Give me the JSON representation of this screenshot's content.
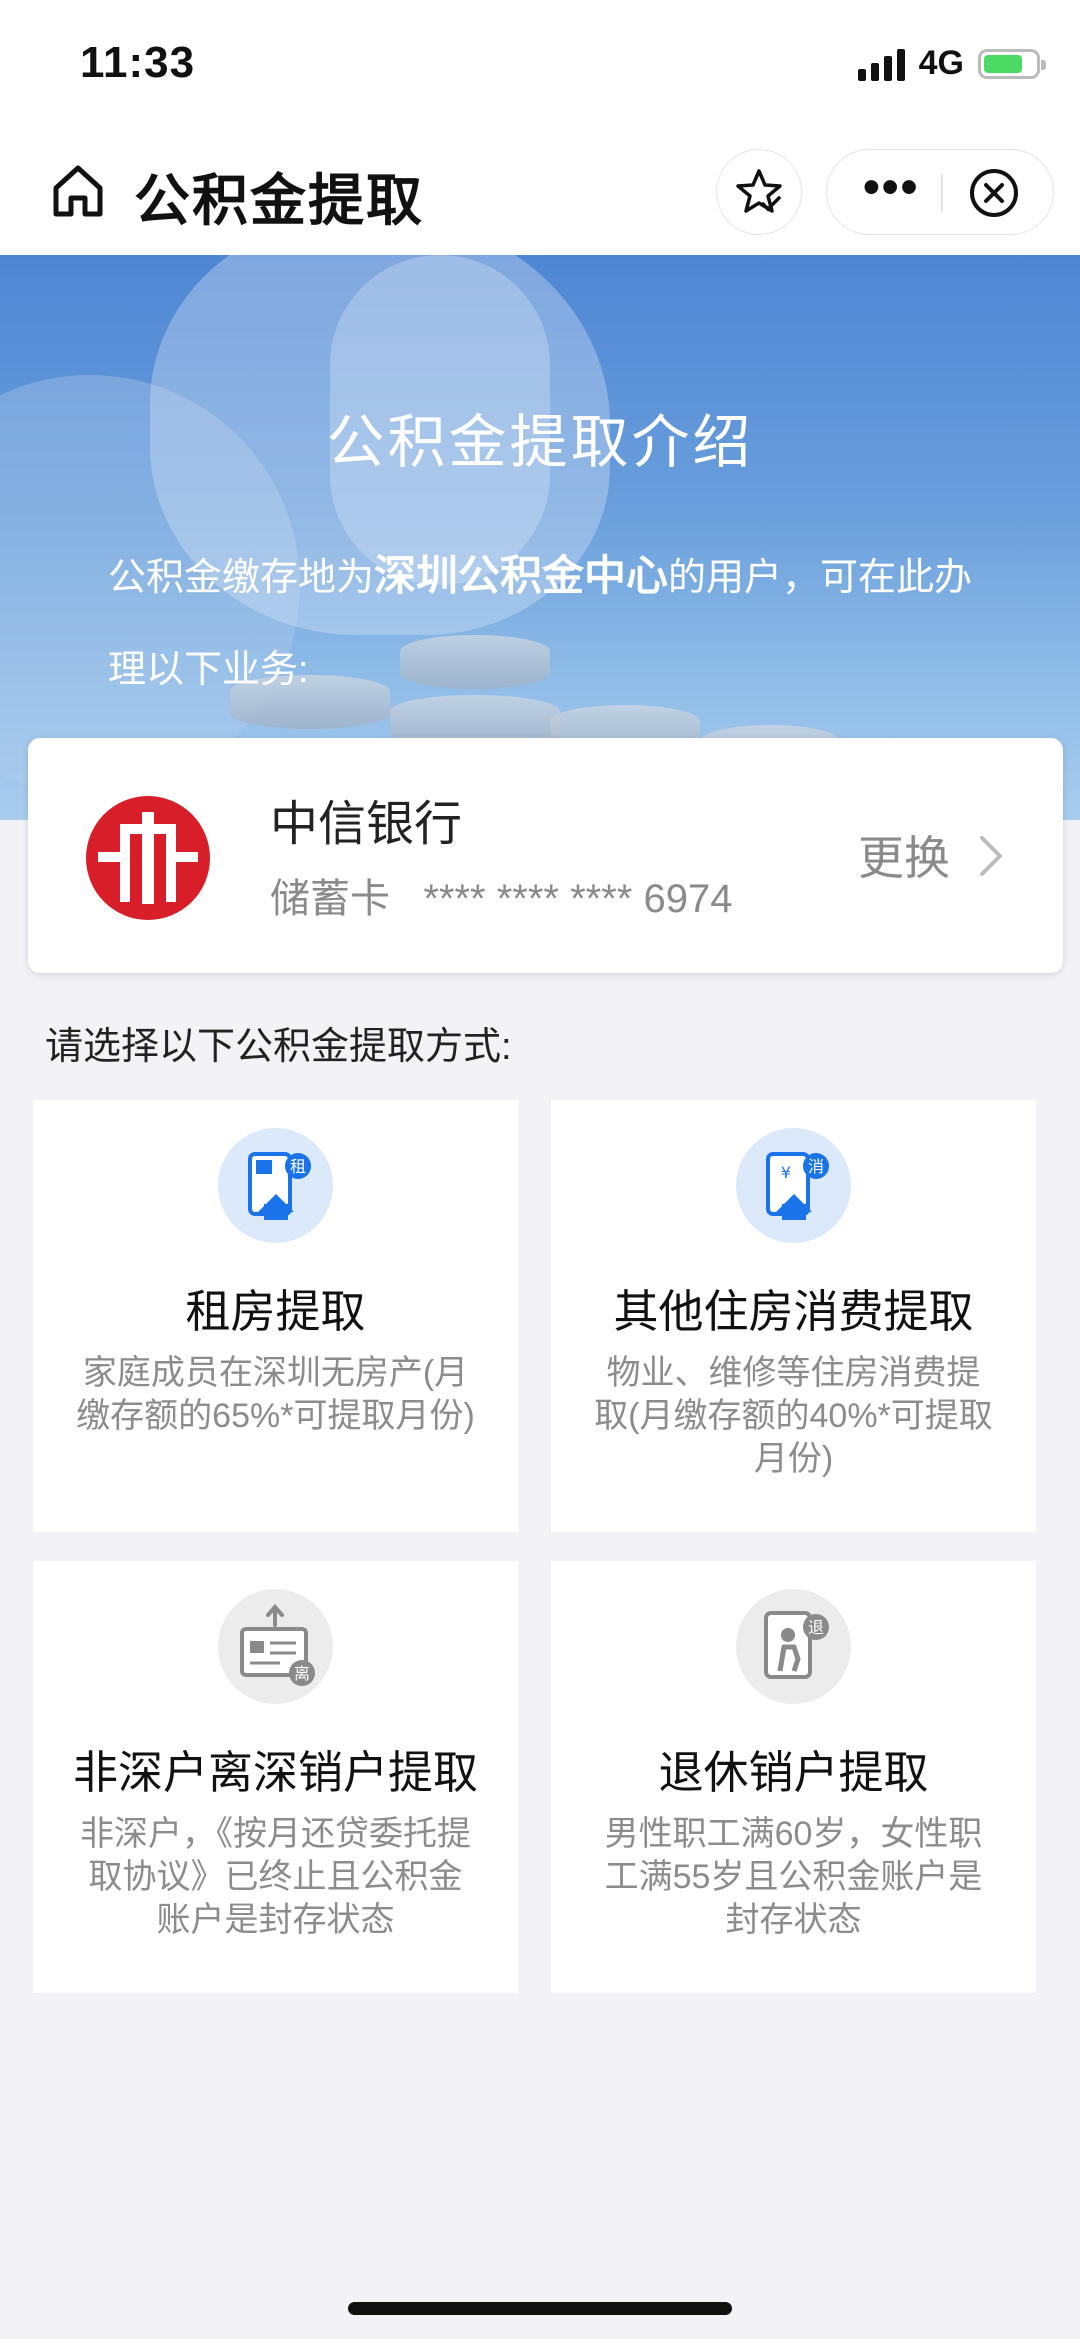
{
  "status_bar": {
    "time": "11:33",
    "network": "4G",
    "battery_level": 0.75
  },
  "navbar": {
    "title": "公积金提取",
    "icons": [
      "home-icon",
      "star-icon",
      "more-icon",
      "close-icon"
    ]
  },
  "banner": {
    "title": "公积金提取介绍",
    "text_prefix": "公积金缴存地为",
    "text_highlight": "深圳公积金中心",
    "text_suffix": "的用户，可在此办理以下业务:"
  },
  "bank_card": {
    "bank_name": "中信银行",
    "card_type": "储蓄卡",
    "card_number": "**** **** **** 6974",
    "change_label": "更换"
  },
  "section_label": "请选择以下公积金提取方式:",
  "options": [
    {
      "title": "租房提取",
      "desc": "家庭成员在深圳无房产(月缴存额的65%*可提取月份)",
      "icon": "rent-icon",
      "badge": "租",
      "accent": "#1a73e8"
    },
    {
      "title": "其他住房消费提取",
      "desc": "物业、维修等住房消费提取(月缴存额的40%*可提取月份)",
      "icon": "housing-consumption-icon",
      "badge": "消",
      "accent": "#1a73e8"
    },
    {
      "title": "非深户离深销户提取",
      "desc": "非深户，《按月还贷委托提取协议》已终止且公积金账户是封存状态",
      "icon": "leave-shenzhen-icon",
      "badge": "离",
      "accent": "#8a8a8a"
    },
    {
      "title": "退休销户提取",
      "desc": "男性职工满60岁，女性职工满55岁且公积金账户是封存状态",
      "icon": "retirement-icon",
      "badge": "退",
      "accent": "#8a8a8a"
    }
  ],
  "colors": {
    "primary_blue": "#1a73e8",
    "icon_bg_blue": "#dbe9fb",
    "icon_bg_gray": "#ececec",
    "bank_red": "#d81e28"
  }
}
